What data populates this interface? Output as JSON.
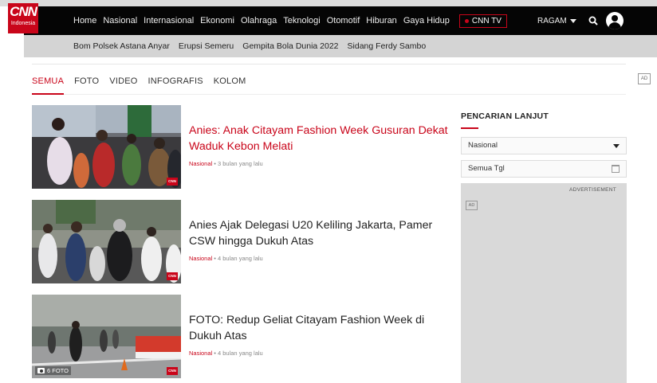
{
  "logo": {
    "brand": "CNN",
    "sub": "Indonesia"
  },
  "nav": {
    "items": [
      "Home",
      "Nasional",
      "Internasional",
      "Ekonomi",
      "Olahraga",
      "Teknologi",
      "Otomotif",
      "Hiburan",
      "Gaya Hidup"
    ],
    "cnntv": "CNN TV",
    "ragam": "RAGAM"
  },
  "subnav": [
    "Bom Polsek Astana Anyar",
    "Erupsi Semeru",
    "Gempita Bola Dunia 2022",
    "Sidang Ferdy Sambo"
  ],
  "tabs": [
    "SEMUA",
    "FOTO",
    "VIDEO",
    "INFOGRAFIS",
    "KOLOM"
  ],
  "articles": [
    {
      "title": "Anies: Anak Citayam Fashion Week Gusuran Dekat Waduk Kebon Melati",
      "category": "Nasional",
      "time": "3 bulan yang lalu",
      "badge": "CNN"
    },
    {
      "title": "Anies Ajak Delegasi U20 Keliling Jakarta, Pamer CSW hingga Dukuh Atas",
      "category": "Nasional",
      "time": "4 bulan yang lalu",
      "badge": "CNN"
    },
    {
      "title": "FOTO: Redup Geliat Citayam Fashion Week di Dukuh Atas",
      "category": "Nasional",
      "time": "4 bulan yang lalu",
      "badge": "CNN",
      "foto_count": "6 FOTO"
    }
  ],
  "sidebar": {
    "title": "PENCARIAN LANJUT",
    "category_select": "Nasional",
    "date_field": "Semua Tgl",
    "ad_label": "ADVERTISEMENT",
    "ad_icon": "AD"
  },
  "ad_corner": "AD",
  "colors": {
    "accent": "#c9051a",
    "nav_bg": "#050505",
    "subnav_bg": "#d4d4d4"
  }
}
